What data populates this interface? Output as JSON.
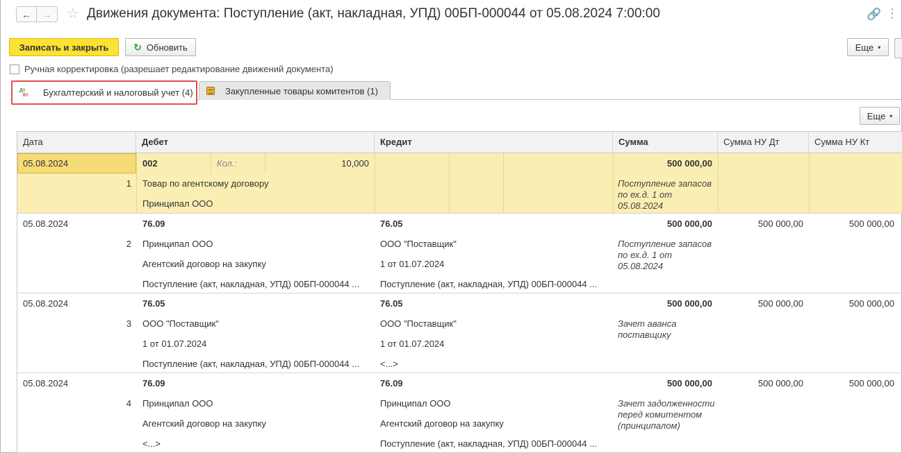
{
  "window": {
    "title": "Движения документа: Поступление (акт, накладная, УПД) 00БП-000044 от 05.08.2024 7:00:00",
    "back_icon": "←",
    "forward_icon": "→",
    "star_icon": "☆",
    "link_icon": "🔗",
    "more_icon": "⋮"
  },
  "toolbar": {
    "write_close_label": "Записать и закрыть",
    "refresh_label": "Обновить",
    "refresh_icon": "↻",
    "more_label": "Еще",
    "caret": "▾"
  },
  "manual_edit": {
    "label": "Ручная корректировка (разрешает редактирование движений документа)",
    "checked": false
  },
  "tabs": [
    {
      "label": "Бухгалтерский и налоговый учет (4)",
      "icon": "dt-kt-icon",
      "icon_dt": "Дт",
      "icon_kt": "Кт",
      "active": true
    },
    {
      "label": "Закупленные товары комитентов (1)",
      "icon": "document-icon",
      "active": false
    }
  ],
  "grid": {
    "more_label": "Еще",
    "columns": [
      "Дата",
      "Дебет",
      "Кредит",
      "Сумма",
      "Сумма НУ Дт",
      "Сумма НУ Кт"
    ],
    "rows": [
      {
        "date": "05.08.2024",
        "num": "1",
        "debit": {
          "account": "002",
          "qty_label": "Кол.:",
          "qty": "10,000",
          "lines": [
            "Товар по агентскому договору",
            "Принципал ООО"
          ]
        },
        "credit": {
          "account": "",
          "lines": []
        },
        "sum": "500 000,00",
        "comment": "Поступление запасов по ех.д. 1 от 05.08.2024",
        "nu_dt": "",
        "nu_kt": "",
        "selected": true
      },
      {
        "date": "05.08.2024",
        "num": "2",
        "debit": {
          "account": "76.09",
          "lines": [
            "Принципал ООО",
            "Агентский договор на закупку",
            "Поступление (акт, накладная, УПД) 00БП-000044 ..."
          ]
        },
        "credit": {
          "account": "76.05",
          "lines": [
            "ООО \"Поставщик\"",
            "1 от 01.07.2024",
            "Поступление (акт, накладная, УПД) 00БП-000044 ..."
          ]
        },
        "sum": "500 000,00",
        "comment": "Поступление запасов по ех.д. 1 от 05.08.2024",
        "nu_dt": "500 000,00",
        "nu_kt": "500 000,00",
        "selected": false
      },
      {
        "date": "05.08.2024",
        "num": "3",
        "debit": {
          "account": "76.05",
          "lines": [
            "ООО \"Поставщик\"",
            "1 от 01.07.2024",
            "Поступление (акт, накладная, УПД) 00БП-000044 ..."
          ]
        },
        "credit": {
          "account": "76.05",
          "lines": [
            "ООО \"Поставщик\"",
            "1 от 01.07.2024",
            "<...>"
          ]
        },
        "sum": "500 000,00",
        "comment": "Зачет аванса поставщику",
        "nu_dt": "500 000,00",
        "nu_kt": "500 000,00",
        "selected": false
      },
      {
        "date": "05.08.2024",
        "num": "4",
        "debit": {
          "account": "76.09",
          "lines": [
            "Принципал ООО",
            "Агентский договор на закупку",
            "<...>"
          ]
        },
        "credit": {
          "account": "76.09",
          "lines": [
            "Принципал ООО",
            "Агентский договор на закупку",
            "Поступление (акт, накладная, УПД) 00БП-000044 ..."
          ]
        },
        "sum": "500 000,00",
        "comment": "Зачет задолженности перед комитентом (принципалом)",
        "nu_dt": "500 000,00",
        "nu_kt": "500 000,00",
        "selected": false
      }
    ]
  }
}
